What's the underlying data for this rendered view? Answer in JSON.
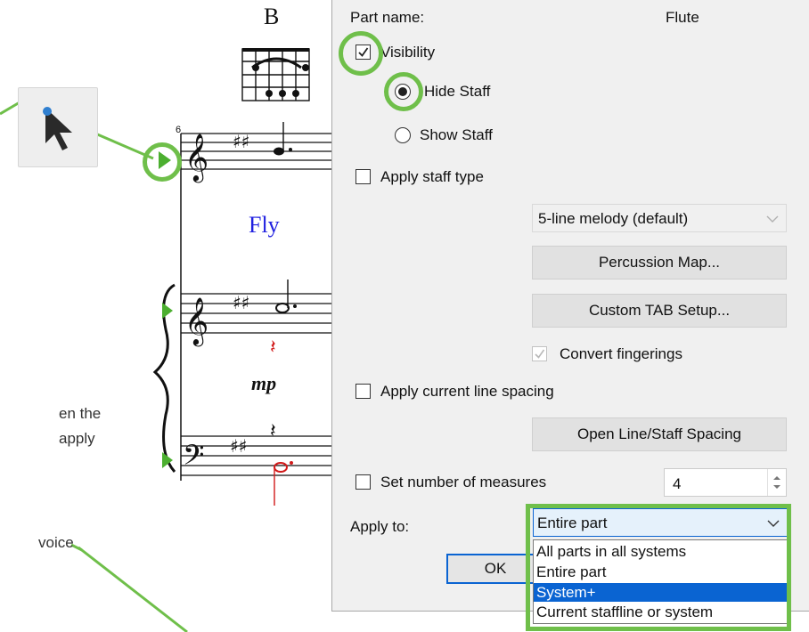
{
  "score": {
    "chord_name": "B",
    "measure_number": "6",
    "lyric": "Fly",
    "dynamic": "mp",
    "side_text_1": "en the",
    "side_text_2": "apply",
    "side_text_3": "voice"
  },
  "dialog": {
    "part_name_label": "Part name:",
    "part_name_value": "Flute",
    "visibility_label": "Visibility",
    "hide_staff_label": "Hide Staff",
    "show_staff_label": "Show Staff",
    "apply_staff_type_label": "Apply staff type",
    "staff_type_value": "5-line melody (default)",
    "percussion_map_label": "Percussion Map...",
    "custom_tab_label": "Custom TAB Setup...",
    "convert_fingerings_label": "Convert fingerings",
    "apply_line_spacing_label": "Apply current line spacing",
    "open_spacing_label": "Open Line/Staff Spacing",
    "set_measures_label": "Set number of measures",
    "measures_value": "4",
    "apply_to_label": "Apply to:",
    "apply_to_value": "Entire part",
    "apply_to_options": [
      "All parts in all systems",
      "Entire part",
      "System+",
      "Current staffline or system"
    ],
    "ok_label": "OK"
  },
  "colors": {
    "highlight_green": "#6fbf4a",
    "selection_blue": "#0a64d2",
    "lyric_blue": "#2020e0",
    "rest_red": "#d11a1a"
  }
}
